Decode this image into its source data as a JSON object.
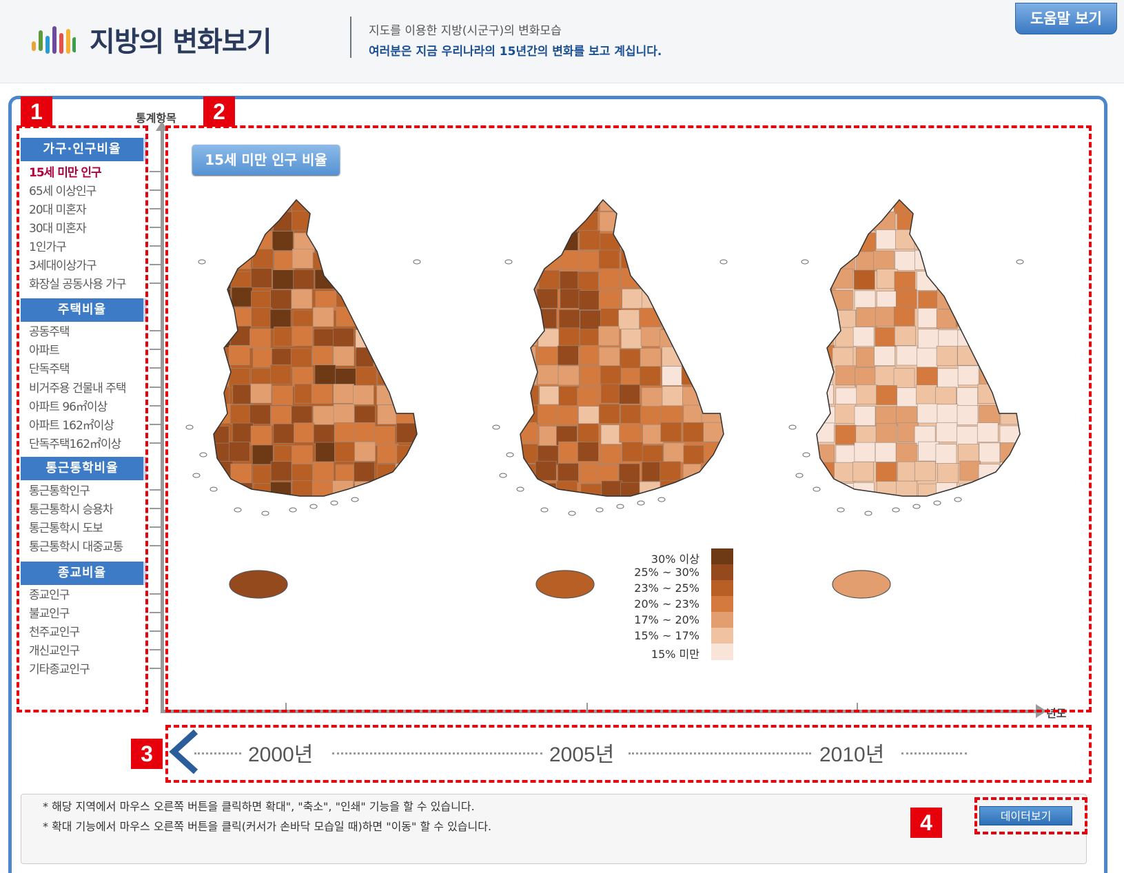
{
  "header": {
    "app_title": "지방의 변화보기",
    "subtitle": "지도를 이용한 지방(시군구)의 변화모습",
    "description": "여러분은 지금 우리나라의 15년간의 변화를 보고 계십니다.",
    "help_button_label": "도움말 보기",
    "logo_colors": [
      "#e8a33b",
      "#5f9b3b",
      "#2a9bd1",
      "#6c4a9e",
      "#e0534f",
      "#f3b234",
      "#3e9e49"
    ]
  },
  "markers": [
    "1",
    "2",
    "3",
    "4"
  ],
  "sidebar": {
    "axis_label": "통계항목",
    "categories": [
      {
        "title": "가구·인구비율",
        "items": [
          "15세 미만 인구",
          "65세 이상인구",
          "20대 미혼자",
          "30대 미혼자",
          "1인가구",
          "3세대이상가구",
          "화장실 공동사용 가구"
        ]
      },
      {
        "title": "주택비율",
        "items": [
          "공동주택",
          "아파트",
          "단독주택",
          "비거주용 건물내 주택",
          "아파트 96㎡이상",
          "아파트 162㎡이상",
          "단독주택162㎡이상"
        ]
      },
      {
        "title": "통근통학비율",
        "items": [
          "통근통학인구",
          "통근통학시 승용차",
          "통근통학시 도보",
          "통근통학시 대중교통"
        ]
      },
      {
        "title": "종교비율",
        "items": [
          "종교인구",
          "불교인구",
          "천주교인구",
          "개신교인구",
          "기타종교인구"
        ]
      }
    ],
    "active_item": "15세 미만 인구"
  },
  "map_view": {
    "stat_title": "15세 미만 인구 비율",
    "year_axis_label": "년도",
    "maps": [
      {
        "year": "2000년",
        "name": "map-2000",
        "shade_level": 4
      },
      {
        "year": "2005년",
        "name": "map-2005",
        "shade_level": 3
      },
      {
        "year": "2010년",
        "name": "map-2010",
        "shade_level": 1
      }
    ],
    "legend": [
      {
        "label": "30% 이상",
        "color": "#6e3a15"
      },
      {
        "label": "25% ~ 30%",
        "color": "#944a1c"
      },
      {
        "label": "23% ~ 25%",
        "color": "#b85f25"
      },
      {
        "label": "20% ~ 23%",
        "color": "#d47a3e"
      },
      {
        "label": "17% ~ 20%",
        "color": "#e29e6e"
      },
      {
        "label": "15% ~ 17%",
        "color": "#efc3a2"
      },
      {
        "label": "15% 미만",
        "color": "#f8e4d8"
      }
    ]
  },
  "timeline": {
    "years": [
      "2000년",
      "2005년",
      "2010년"
    ],
    "prev_icon": "chevron-left-icon"
  },
  "notes": [
    "* 해당 지역에서 마우스 오른쪽 버튼을 클릭하면 확대\", \"축소\", \"인쇄\" 기능을 할 수 있습니다.",
    "* 확대 기능에서 마우스 오른쪽 버튼을 클릭(커서가 손바닥 모습일 때)하면 \"이동\" 할 수 있습니다."
  ],
  "data_view_button_label": "데이터보기",
  "accent_color": "#4a87cc",
  "marker_color": "#e6000b"
}
